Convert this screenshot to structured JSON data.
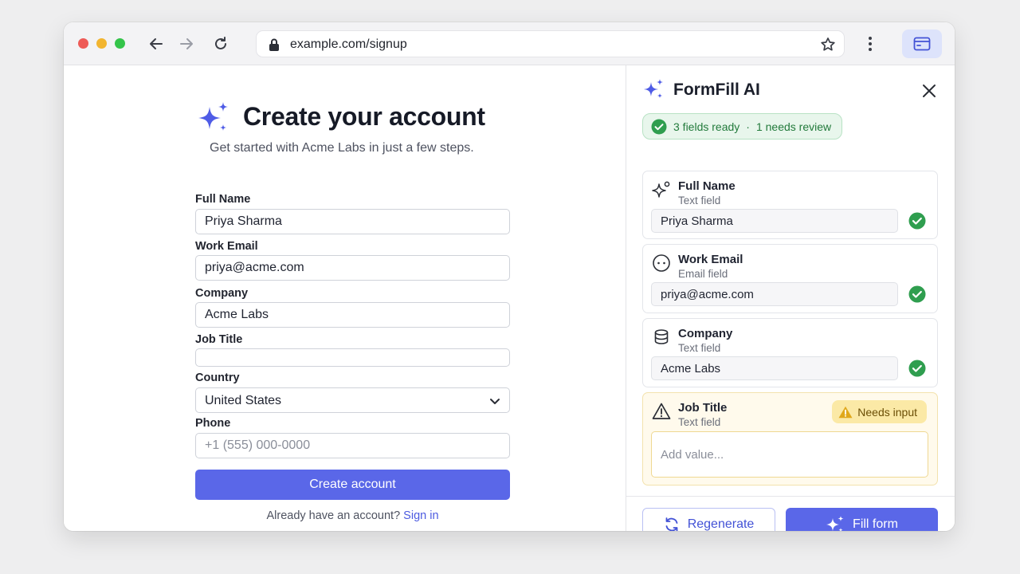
{
  "browser": {
    "url": "example.com/signup",
    "controls": {
      "close_color": "#ee5b57",
      "minimize_color": "#f2b530",
      "maximize_color": "#34c44a"
    },
    "icons": [
      "back-arrow-icon",
      "forward-arrow-icon",
      "reload-icon",
      "lock-icon",
      "star-icon",
      "more-vertical-icon",
      "side-panel-icon"
    ]
  },
  "page": {
    "title": "Create your account",
    "subtitle": "Get started with Acme Labs in just a few steps.",
    "fields": {
      "full_name": {
        "label": "Full Name",
        "value": "Priya Sharma"
      },
      "work_email": {
        "label": "Work Email",
        "value": "priya@acme.com"
      },
      "company": {
        "label": "Company",
        "value": "Acme Labs"
      },
      "job_title": {
        "label": "Job Title",
        "value": ""
      },
      "country": {
        "label": "Country",
        "value": "United States"
      },
      "phone": {
        "label": "Phone",
        "placeholder": "+1 (555) 000-0000"
      }
    },
    "submit_label": "Create account",
    "signin_prompt": "Already have an account?",
    "signin_link": "Sign in"
  },
  "panel": {
    "title": "FormFill AI",
    "status": {
      "ready": "3 fields ready",
      "separator": "·",
      "review": "1 needs review"
    },
    "cards": [
      {
        "name": "Full Name",
        "type": "Text field",
        "value": "Priya Sharma",
        "icon": "sparkle-icon",
        "status": "ready"
      },
      {
        "name": "Work Email",
        "type": "Email field",
        "value": "priya@acme.com",
        "icon": "email-icon",
        "status": "ready"
      },
      {
        "name": "Company",
        "type": "Text field",
        "value": "Acme Labs",
        "icon": "company-icon",
        "status": "ready"
      },
      {
        "name": "Job Title",
        "type": "Text field",
        "placeholder": "Add value...",
        "badge": "Needs input",
        "icon": "warning-icon",
        "status": "needs-input"
      }
    ],
    "regenerate_label": "Regenerate",
    "fill_label": "Fill form"
  },
  "colors": {
    "accent": "#5a67e8",
    "success": "#2f9e4f",
    "warning": "#e0a81a",
    "link": "#4c5ae0"
  }
}
